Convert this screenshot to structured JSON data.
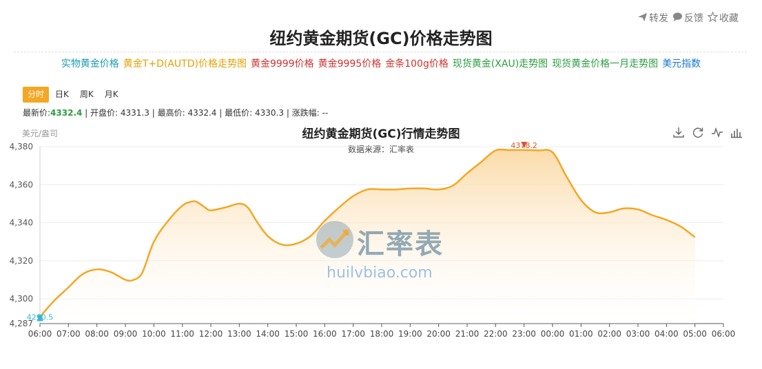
{
  "actions": [
    {
      "label": "转发",
      "icon": "send-icon"
    },
    {
      "label": "反馈",
      "icon": "comment-icon"
    },
    {
      "label": "收藏",
      "icon": "star-icon"
    }
  ],
  "page_title": "纽约黄金期货(GC)价格走势图",
  "links": [
    {
      "label": "实物黄金价格",
      "color": "#1a9bb5"
    },
    {
      "label": "黄金T+D(AUTD)价格走势图",
      "color": "#e6a000"
    },
    {
      "label": "黄金9999价格",
      "color": "#d0312d"
    },
    {
      "label": "黄金9995价格",
      "color": "#d0312d"
    },
    {
      "label": "金条100g价格",
      "color": "#d0312d"
    },
    {
      "label": "现货黄金(XAU)走势图",
      "color": "#2a9d3f"
    },
    {
      "label": "现货黄金价格一月走势图",
      "color": "#2a9d3f"
    },
    {
      "label": "美元指数",
      "color": "#1677d2"
    }
  ],
  "tabs": [
    {
      "label": "分时",
      "active": true
    },
    {
      "label": "日K",
      "active": false
    },
    {
      "label": "周K",
      "active": false
    },
    {
      "label": "月K",
      "active": false
    }
  ],
  "quote": {
    "last_label": "最新价:",
    "last_value": "4332.4",
    "open_label": "开盘价:",
    "open_value": "4331.3",
    "high_label": "最高价:",
    "high_value": "4332.4",
    "low_label": "最低价:",
    "low_value": "4330.3",
    "change_label": "涨跌幅:",
    "change_value": "--"
  },
  "toolbox": [
    {
      "icon": "download-icon"
    },
    {
      "icon": "refresh-icon"
    },
    {
      "icon": "line-chart-icon"
    },
    {
      "icon": "bar-chart-icon"
    }
  ],
  "watermark": {
    "text": "汇率表",
    "url": "huilvbiao.com"
  },
  "colors": {
    "line": "#f5a623",
    "area_top": "#fbd9a4",
    "max_marker": "#e0522b",
    "min_marker": "#35b8d8"
  },
  "chart_data": {
    "type": "area",
    "title": "纽约黄金期货(GC)行情走势图",
    "subtitle": "数据来源：汇率表",
    "ylabel": "美元/盎司",
    "xlabel": "",
    "ylim": [
      4287,
      4380
    ],
    "yticks": [
      {
        "value": 4287,
        "label": "4,287"
      },
      {
        "value": 4300,
        "label": "4,300"
      },
      {
        "value": 4320,
        "label": "4,320"
      },
      {
        "value": 4340,
        "label": "4,340"
      },
      {
        "value": 4360,
        "label": "4,360"
      },
      {
        "value": 4380,
        "label": "4,380"
      }
    ],
    "xticks": [
      "06:00",
      "07:00",
      "08:00",
      "09:00",
      "10:00",
      "11:00",
      "12:00",
      "13:00",
      "14:00",
      "15:00",
      "16:00",
      "17:00",
      "18:00",
      "19:00",
      "20:00",
      "21:00",
      "22:00",
      "23:00",
      "00:00",
      "01:00",
      "02:00",
      "03:00",
      "04:00",
      "05:00",
      "06:00"
    ],
    "grid": true,
    "x_hours": [
      0,
      0.5,
      1,
      1.5,
      2,
      2.5,
      3,
      3.3,
      3.6,
      4,
      4.5,
      5,
      5.3,
      5.5,
      5.8,
      6,
      6.5,
      7,
      7.3,
      7.6,
      8,
      8.5,
      9,
      9.5,
      10,
      10.5,
      11,
      11.5,
      12,
      12.5,
      13,
      13.5,
      14,
      14.5,
      15,
      15.5,
      16,
      16.5,
      17,
      17.5,
      18,
      18.5,
      19,
      19.5,
      20,
      20.5,
      21,
      21.5,
      22,
      22.5,
      23
    ],
    "values": [
      4290.5,
      4299,
      4306,
      4313,
      4315.5,
      4314,
      4310,
      4310,
      4314,
      4330,
      4341,
      4349,
      4351,
      4351,
      4348,
      4346.5,
      4348,
      4350,
      4348,
      4341,
      4333,
      4328.5,
      4329,
      4333,
      4341,
      4348,
      4354,
      4357.5,
      4357.5,
      4357.5,
      4358,
      4358,
      4357.5,
      4359.5,
      4366,
      4372,
      4378,
      4378.2,
      4378.2,
      4378,
      4377,
      4364,
      4352,
      4345.5,
      4345.5,
      4347.5,
      4347,
      4344,
      4341.5,
      4338,
      4332.4
    ],
    "markers": [
      {
        "type": "max",
        "x_hour": 17,
        "value": 4378.2,
        "label": "4378.2"
      },
      {
        "type": "min",
        "x_hour": 0,
        "value": 4290.5,
        "label": "4290.5"
      }
    ]
  }
}
